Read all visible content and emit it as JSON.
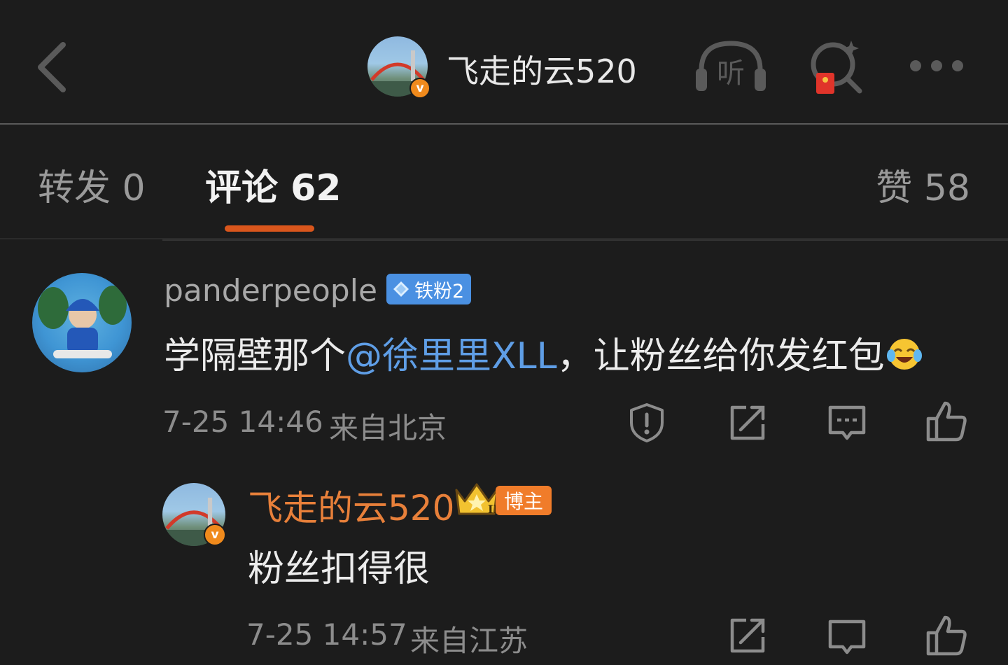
{
  "header": {
    "blogger_name": "飞走的云520",
    "verified_badge": "v",
    "listen_label": "听",
    "icons": [
      "back-arrow-icon",
      "listen-headphone-icon",
      "search-redpacket-icon",
      "more-dots-icon"
    ]
  },
  "tabs": [
    {
      "label": "转发 0"
    },
    {
      "label": "评论 62",
      "active": true
    },
    {
      "label": "赞 58"
    }
  ],
  "comment": {
    "username": "panderpeople",
    "fan_badge": "铁粉2",
    "text_before": "学隔壁那个",
    "mention": "@徐里里XLL",
    "text_after": "，让粉丝给你发红包",
    "emoji": "laughing-tears-emoji",
    "time": "7-25 14:46",
    "location": "来自北京",
    "actions": [
      "report-icon",
      "share-icon",
      "reply-comment-icon",
      "like-icon"
    ]
  },
  "reply": {
    "username": "飞走的云520",
    "verified_badge": "v",
    "crown_level": "II",
    "role_badge": "博主",
    "text": "粉丝扣得很",
    "time": "7-25 14:57",
    "location": "来自江苏",
    "actions": [
      "share-icon",
      "reply-comment-icon",
      "like-icon"
    ]
  },
  "colors": {
    "background": "#1c1c1c",
    "accent_orange": "#d9561c",
    "mention_blue": "#5f9ee6",
    "blogger_name_orange": "#e8803a",
    "fan_badge_blue": "#4a90e2"
  }
}
